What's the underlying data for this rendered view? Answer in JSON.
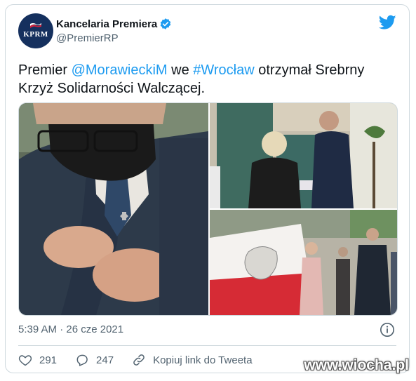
{
  "author": {
    "display_name": "Kancelaria Premiera",
    "handle": "@PremierRP",
    "avatar_text": "KPRM",
    "verified": true
  },
  "tweet": {
    "text_parts": [
      {
        "type": "text",
        "value": "Premier "
      },
      {
        "type": "mention",
        "value": "@MorawieckiM"
      },
      {
        "type": "text",
        "value": " we "
      },
      {
        "type": "hashtag",
        "value": "#Wrocław"
      },
      {
        "type": "text",
        "value": " otrzymał Srebrny Krzyż Solidarności Walczącej."
      }
    ],
    "timestamp": "5:39 AM · 26 cze 2021"
  },
  "media": {
    "photos": [
      "photo-minister-pinning-cross",
      "photo-award-ceremony",
      "photo-flag-ceremony"
    ]
  },
  "actions": {
    "likes": "291",
    "replies": "247",
    "copy_link_label": "Kopiuj link do Tweeta"
  },
  "watermark": "www.wiocha.pl",
  "colors": {
    "accent": "#1d9bf0",
    "text": "#0f1419",
    "secondary_text": "#536471",
    "border": "#cfd9de",
    "avatar_bg": "#15305e"
  }
}
